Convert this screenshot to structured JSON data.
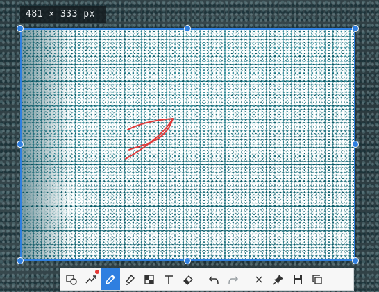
{
  "size_label": "481 × 333 px",
  "annotation_color": "#e03a3a",
  "selection_color": "#2f7fe0",
  "toolbar": {
    "tools": [
      {
        "name": "shape-tool",
        "icon": "shape-icon"
      },
      {
        "name": "polyline-tool",
        "icon": "polyline-icon",
        "has_badge": true
      },
      {
        "name": "pen-tool",
        "icon": "pen-icon",
        "active": true
      },
      {
        "name": "marker-tool",
        "icon": "marker-icon"
      },
      {
        "name": "mosaic-tool",
        "icon": "mosaic-icon"
      },
      {
        "name": "text-tool",
        "icon": "text-icon"
      },
      {
        "name": "eraser-tool",
        "icon": "eraser-icon"
      },
      {
        "name": "undo-button",
        "icon": "undo-icon"
      },
      {
        "name": "redo-button",
        "icon": "redo-icon"
      },
      {
        "name": "close-button",
        "icon": "close-icon"
      },
      {
        "name": "pin-button",
        "icon": "pin-icon"
      },
      {
        "name": "save-button",
        "icon": "save-icon"
      },
      {
        "name": "copy-button",
        "icon": "copy-icon"
      }
    ]
  }
}
